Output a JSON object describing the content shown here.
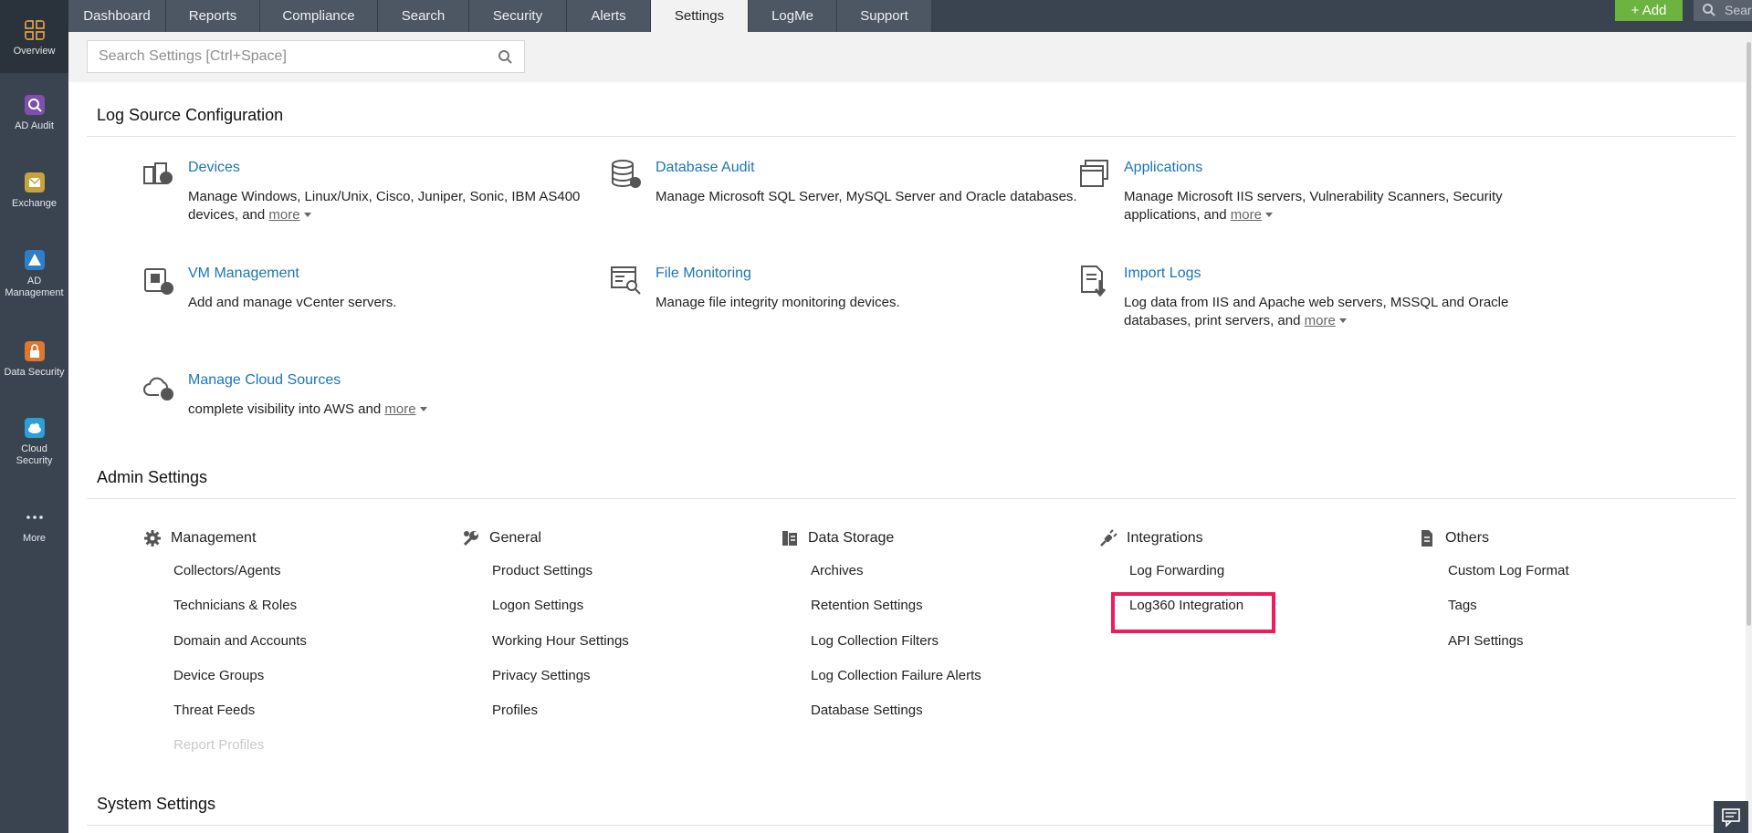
{
  "rail": [
    {
      "label": "Overview"
    },
    {
      "label": "AD Audit"
    },
    {
      "label": "Exchange"
    },
    {
      "label": "AD Management"
    },
    {
      "label": "Data Security"
    },
    {
      "label": "Cloud Security"
    },
    {
      "label": "More"
    }
  ],
  "tabs": [
    "Dashboard",
    "Reports",
    "Compliance",
    "Search",
    "Security",
    "Alerts",
    "Settings",
    "LogMe",
    "Support"
  ],
  "active_tab": "Settings",
  "top": {
    "add_label": "+ Add",
    "search_placeholder": "Search"
  },
  "settings_search": {
    "placeholder": "Search Settings [Ctrl+Space]"
  },
  "log_source": {
    "title": "Log Source Configuration",
    "items": [
      {
        "title": "Devices",
        "desc": "Manage Windows, Linux/Unix, Cisco, Juniper, Sonic, IBM AS400 devices, and",
        "more": "more",
        "icon": "devices-icon"
      },
      {
        "title": "Database Audit",
        "desc": "Manage Microsoft SQL Server, MySQL Server and Oracle databases.",
        "more": "",
        "icon": "database-icon"
      },
      {
        "title": "Applications",
        "desc": "Manage Microsoft IIS servers, Vulnerability Scanners, Security applications, and",
        "more": "more",
        "icon": "applications-icon"
      },
      {
        "title": "VM Management",
        "desc": "Add and manage vCenter servers.",
        "more": "",
        "icon": "vm-icon"
      },
      {
        "title": "File Monitoring",
        "desc": "Manage file integrity monitoring devices.",
        "more": "",
        "icon": "file-monitor-icon"
      },
      {
        "title": "Import Logs",
        "desc": "Log data from IIS and Apache web servers, MSSQL and Oracle databases, print servers, and",
        "more": "more",
        "icon": "import-icon"
      },
      {
        "title": "Manage Cloud Sources",
        "desc": "complete visibility into AWS and",
        "more": "more",
        "icon": "cloud-icon"
      }
    ]
  },
  "admin": {
    "title": "Admin Settings",
    "columns": [
      {
        "head": "Management",
        "items": [
          "Collectors/Agents",
          "Technicians & Roles",
          "Domain and Accounts",
          "Device Groups",
          "Threat Feeds",
          "Report Profiles"
        ]
      },
      {
        "head": "General",
        "items": [
          "Product Settings",
          "Logon Settings",
          "Working Hour Settings",
          "Privacy Settings",
          "Profiles"
        ]
      },
      {
        "head": "Data Storage",
        "items": [
          "Archives",
          "Retention Settings",
          "Log Collection Filters",
          "Log Collection Failure Alerts",
          "Database Settings"
        ]
      },
      {
        "head": "Integrations",
        "items": [
          "Log Forwarding",
          "Log360 Integration"
        ]
      },
      {
        "head": "Others",
        "items": [
          "Custom Log Format",
          "Tags",
          "API Settings"
        ]
      }
    ]
  },
  "system": {
    "title": "System Settings"
  },
  "colors": {
    "rail_bg": "#3a4450",
    "link": "#1b76b6",
    "add_green": "#6cb33f",
    "highlight": "#ef1b5a"
  }
}
